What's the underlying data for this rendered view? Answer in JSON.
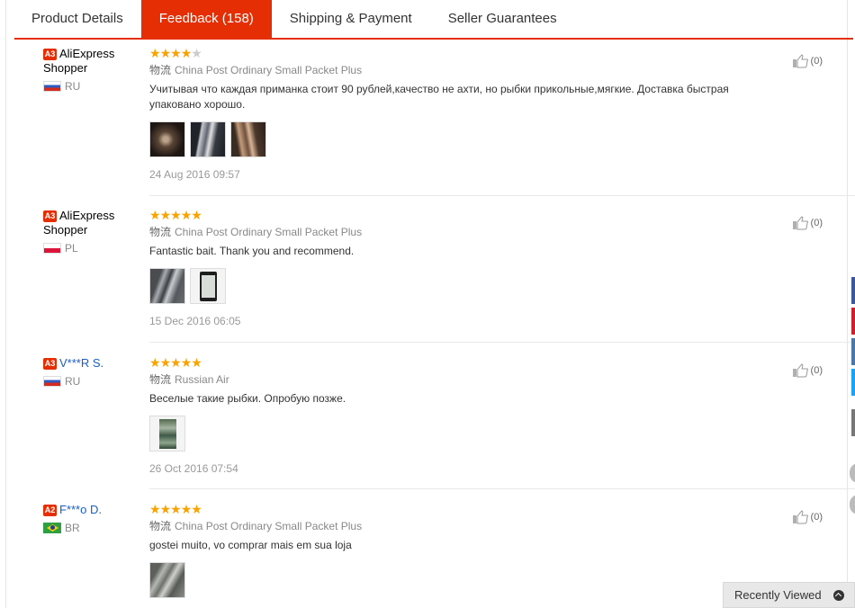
{
  "tabs": [
    {
      "label": "Product Details",
      "active": false
    },
    {
      "label": "Feedback (158)",
      "active": true
    },
    {
      "label": "Shipping & Payment",
      "active": false
    },
    {
      "label": "Seller Guarantees",
      "active": false
    }
  ],
  "reviews": [
    {
      "level": "A3",
      "name_line1": "AliExpress",
      "name_line2": "Shopper",
      "country": "RU",
      "rating_stars": 4,
      "logistics_label": "物流",
      "logistics": "China Post Ordinary Small Packet Plus",
      "text": "Учитывая что каждая приманка стоит 90 рублей,качество не ахти, но рыбки прикольные,мягкие. Доставка быстрая упаковано хорошо.",
      "photo_count": 3,
      "date": "24 Aug 2016 09:57",
      "likes": "(0)"
    },
    {
      "level": "A3",
      "name_line1": "AliExpress",
      "name_line2": "Shopper",
      "country": "PL",
      "rating_stars": 5,
      "logistics_label": "物流",
      "logistics": "China Post Ordinary Small Packet Plus",
      "text": "Fantastic bait. Thank you and recommend.",
      "photo_count": 2,
      "date": "15 Dec 2016 06:05",
      "likes": "(0)"
    },
    {
      "level": "A3",
      "name_line1": "V***R S.",
      "country": "RU",
      "rating_stars": 5,
      "logistics_label": "物流",
      "logistics": "Russian Air",
      "text": "Веселые такие рыбки. Опробую позже.",
      "photo_count": 1,
      "date": "26 Oct 2016 07:54",
      "likes": "(0)"
    },
    {
      "level": "A2",
      "name_line1": "F***o D.",
      "country": "BR",
      "rating_stars": 5,
      "logistics_label": "物流",
      "logistics": "China Post Ordinary Small Packet Plus",
      "text": "gostei muito, vo comprar mais em sua loja",
      "photo_count": 1,
      "likes": "(0)"
    }
  ],
  "recently_viewed": "Recently Viewed",
  "colors": {
    "accent": "#e62e04",
    "star": "#f8a300",
    "link": "#1a5ec6"
  },
  "icons": {
    "like": "thumbs-up-icon",
    "recently_viewed": "chevron-up-circle-icon"
  }
}
